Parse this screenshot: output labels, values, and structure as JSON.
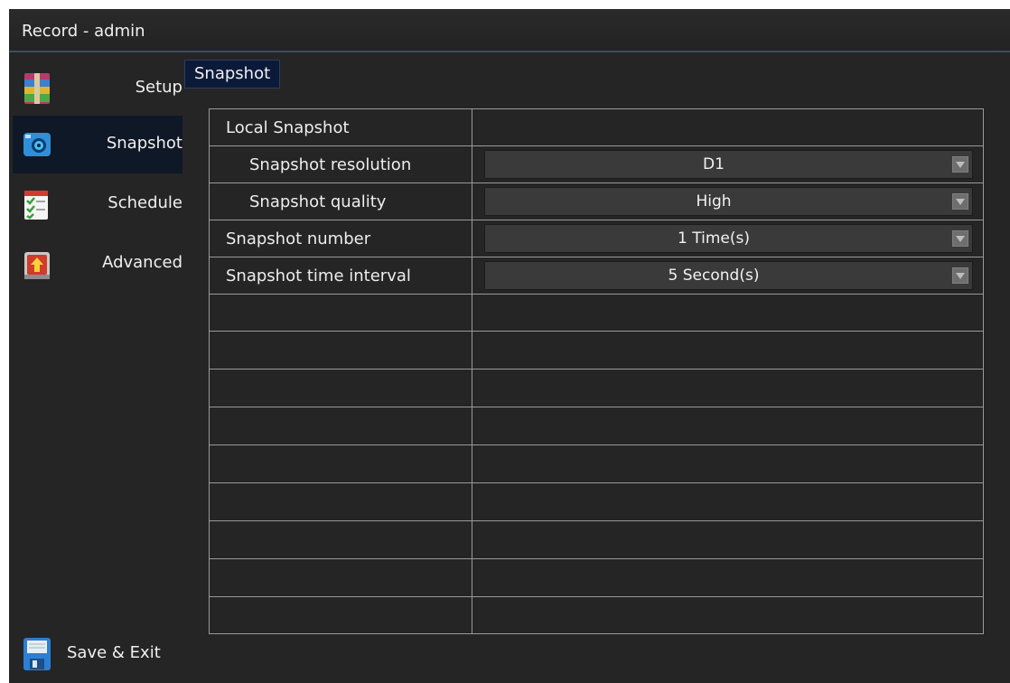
{
  "window": {
    "title": "Record - admin"
  },
  "sidebar": {
    "items": [
      {
        "label": "Setup",
        "icon": "archive-icon"
      },
      {
        "label": "Snapshot",
        "icon": "camera-icon",
        "active": true
      },
      {
        "label": "Schedule",
        "icon": "calendar-checklist-icon"
      },
      {
        "label": "Advanced",
        "icon": "upload-arrow-icon"
      }
    ],
    "save_exit_label": "Save & Exit"
  },
  "tab": {
    "label": "Snapshot"
  },
  "settings": {
    "section_label": "Local Snapshot",
    "rows": [
      {
        "label": "Snapshot resolution",
        "value": "D1"
      },
      {
        "label": "Snapshot quality",
        "value": "High"
      },
      {
        "label": "Snapshot number",
        "value": "1 Time(s)"
      },
      {
        "label": "Snapshot time interval",
        "value": "5 Second(s)"
      }
    ]
  },
  "colors": {
    "background": "#252525",
    "active_item": "#0f1826",
    "tab_background": "#0c1a3a",
    "grid_line": "#9a9a9a"
  }
}
